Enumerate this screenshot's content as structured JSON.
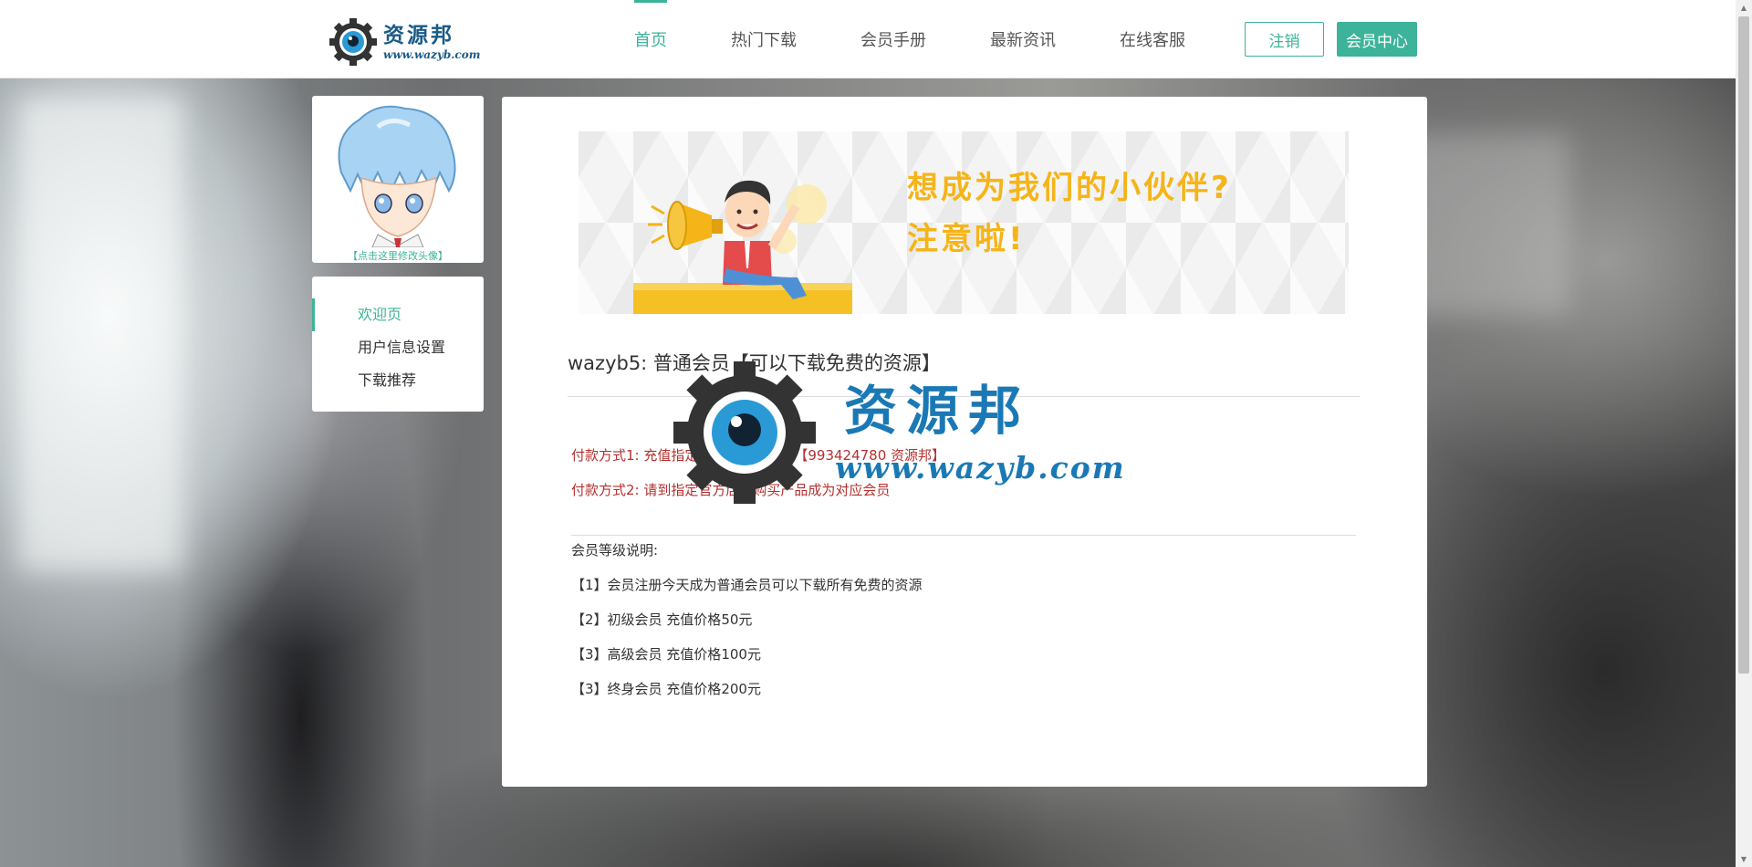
{
  "header": {
    "logo_cn": "资源邦",
    "logo_en": "www.wazyb.com",
    "nav": [
      {
        "label": "首页",
        "active": true
      },
      {
        "label": "热门下载",
        "active": false
      },
      {
        "label": "会员手册",
        "active": false
      },
      {
        "label": "最新资讯",
        "active": false
      },
      {
        "label": "在线客服",
        "active": false
      }
    ],
    "logout_label": "注销",
    "member_center_label": "会员中心"
  },
  "sidebar": {
    "avatar_hint": "【点击这里修改头像】",
    "menu": [
      {
        "label": "欢迎页",
        "active": true
      },
      {
        "label": "用户信息设置",
        "active": false
      },
      {
        "label": "下载推荐",
        "active": false
      }
    ]
  },
  "main": {
    "banner": {
      "line1": "想成为我们的小伙伴?",
      "line2": "注意啦!"
    },
    "user_title": "wazyb5: 普通会员【可以下载免费的资源】",
    "payment": [
      "付款方式1:  充值指定官方支付宝账号【993424780 资源邦】",
      "付款方式2:  请到指定官方店铺购买产品成为对应会员"
    ],
    "level_title": "会员等级说明:",
    "levels": [
      "【1】会员注册今天成为普通会员可以下载所有免费的资源",
      "【2】初级会员 充值价格50元",
      "【3】高级会员 充值价格100元",
      "【3】终身会员 充值价格200元"
    ]
  },
  "watermark": {
    "cn": "资源邦",
    "en": "www.wazyb.com"
  },
  "colors": {
    "accent": "#3cb39a",
    "pay_text": "#b53030",
    "logo_blue": "#1a5a86",
    "banner_yellow": "#f5b418"
  }
}
